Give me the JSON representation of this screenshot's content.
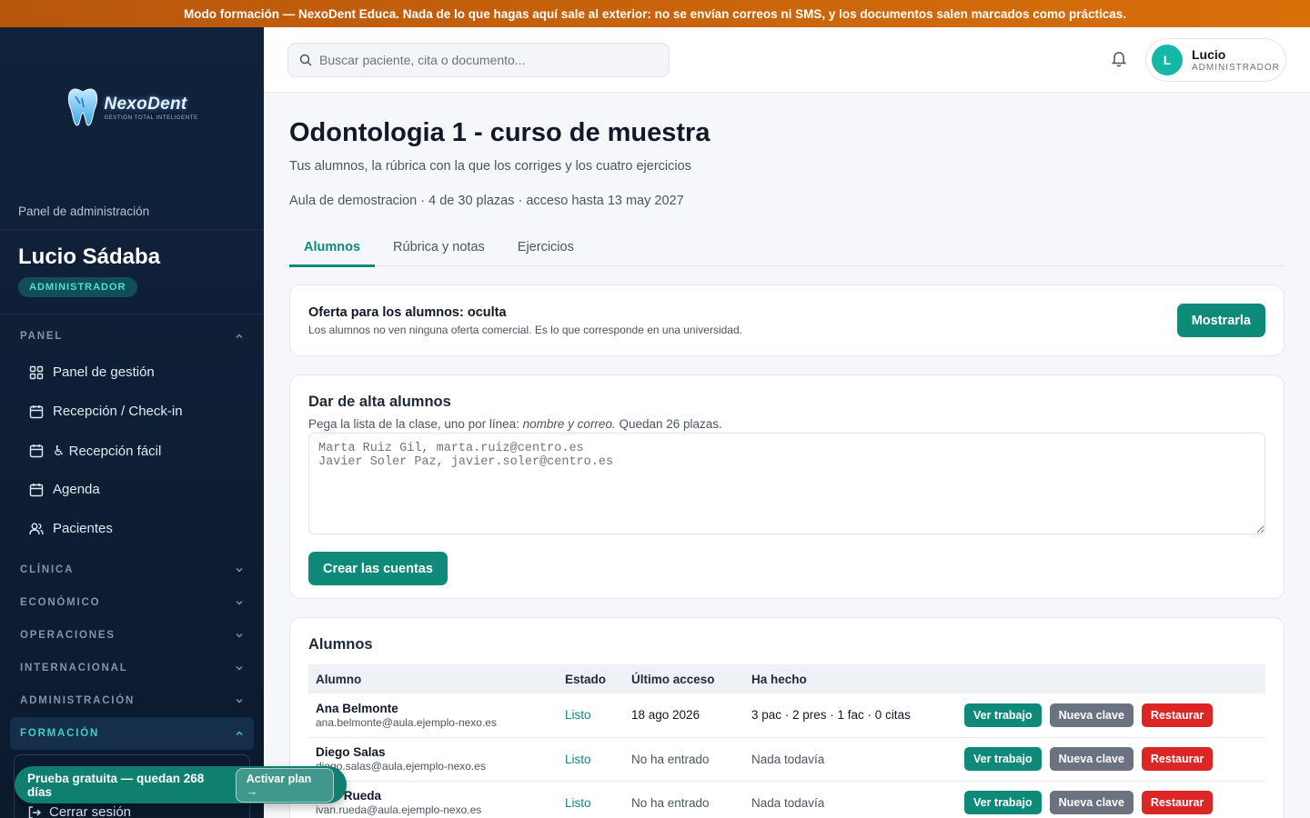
{
  "banner": {
    "text": "Modo formación — NexoDent Educa. Nada de lo que hagas aquí sale al exterior: no se envían correos ni SMS, y los documentos salen marcados como prácticas."
  },
  "sidebar": {
    "logo_name": "NexoDent",
    "logo_tagline": "GESTIÓN TOTAL INTELIGENTE",
    "panel_label": "Panel de administración",
    "user_name": "Lucio Sádaba",
    "user_role": "ADMINISTRADOR",
    "panel_section": "PANEL",
    "items": [
      {
        "label": "Panel de gestión",
        "icon": "grid-icon"
      },
      {
        "label": "Recepción / Check-in",
        "icon": "calendar-icon"
      },
      {
        "label": "♿ Recepción fácil",
        "icon": "calendar-icon"
      },
      {
        "label": "Agenda",
        "icon": "calendar-icon"
      },
      {
        "label": "Pacientes",
        "icon": "users-icon"
      }
    ],
    "sections": [
      "CLÍNICA",
      "ECONÓMICO",
      "OPERACIONES",
      "INTERNACIONAL",
      "ADMINISTRACIÓN"
    ],
    "active_section": "FORMACIÓN",
    "trial_text": "Prueba gratuita — quedan 268 días",
    "trial_button": "Activar plan →",
    "logout": "Cerrar sesión"
  },
  "topbar": {
    "search_placeholder": "Buscar paciente, cita o documento...",
    "user_name": "Lucio",
    "user_role": "ADMINISTRADOR",
    "avatar_initial": "L"
  },
  "main": {
    "title": "Odontologia 1 - curso de muestra",
    "subtitle": "Tus alumnos, la rúbrica con la que los corriges y los cuatro ejercicios",
    "meta": "Aula de demostracion · 4 de 30 plazas · acceso hasta 13 may 2027",
    "tabs": [
      {
        "label": "Alumnos"
      },
      {
        "label": "Rúbrica y notas"
      },
      {
        "label": "Ejercicios"
      }
    ],
    "offer": {
      "title": "Oferta para los alumnos: oculta",
      "desc": "Los alumnos no ven ninguna oferta comercial. Es lo que corresponde en una universidad.",
      "button": "Mostrarla"
    },
    "alta": {
      "title": "Dar de alta alumnos",
      "hint_prefix": "Pega la lista de la clase, uno por línea: ",
      "hint_em": "nombre y correo.",
      "hint_suffix": " Quedan 26 plazas.",
      "placeholder": "Marta Ruiz Gil, marta.ruiz@centro.es\nJavier Soler Paz, javier.soler@centro.es",
      "button": "Crear las cuentas"
    },
    "students": {
      "title": "Alumnos",
      "headers": [
        "Alumno",
        "Estado",
        "Último acceso",
        "Ha hecho"
      ],
      "rows": [
        {
          "name": "Ana Belmonte",
          "email": "ana.belmonte@aula.ejemplo-nexo.es",
          "estado": "Listo",
          "acceso": "18 ago 2026",
          "hecho": "3 pac · 2 pres · 1 fac · 0 citas"
        },
        {
          "name": "Diego Salas",
          "email": "diego.salas@aula.ejemplo-nexo.es",
          "estado": "Listo",
          "acceso": "No ha entrado",
          "hecho": "Nada todavía"
        },
        {
          "name": "Iván Rueda",
          "email": "ivan.rueda@aula.ejemplo-nexo.es",
          "estado": "Listo",
          "acceso": "No ha entrado",
          "hecho": "Nada todavía"
        }
      ],
      "actions": {
        "view": "Ver trabajo",
        "reset_key": "Nueva clave",
        "restore": "Restaurar"
      }
    }
  }
}
